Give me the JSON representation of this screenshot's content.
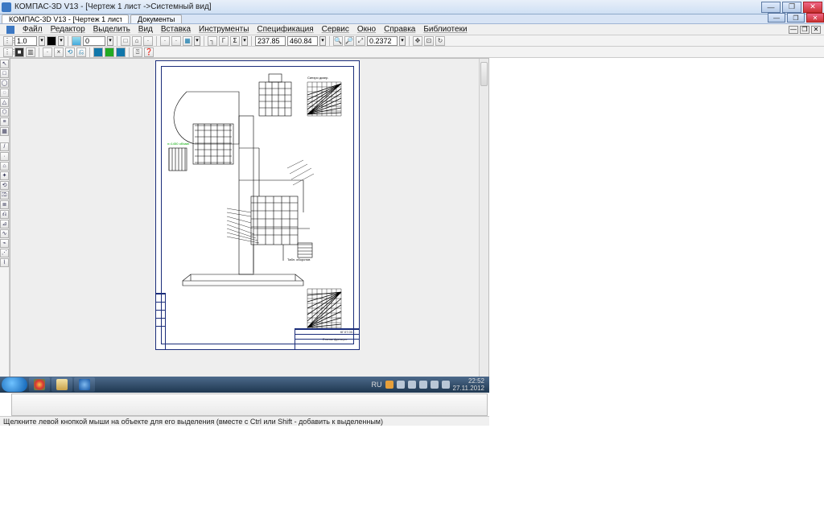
{
  "window": {
    "title": "КОМПАС-3D V13 - [Чертеж 1 лист ->Системный вид]",
    "min": "—",
    "max": "❐",
    "close": "✕"
  },
  "browser_tab": {
    "bg_title": "Документы"
  },
  "menu": {
    "items": [
      "Файл",
      "Редактор",
      "Выделить",
      "Вид",
      "Вставка",
      "Инструменты",
      "Спецификация",
      "Сервис",
      "Окно",
      "Справка",
      "Библиотеки"
    ]
  },
  "mdi": {
    "restore": "❐",
    "min": "—",
    "close": "✕"
  },
  "toolbar2": {
    "line_style_value": "1.0",
    "layer_value": "0",
    "coord_x": "237.85",
    "coord_y": "460.84",
    "zoom_value": "0.2372"
  },
  "left_tools": [
    "↖",
    "□",
    "◯",
    "◌",
    "△",
    "⬡",
    "≡",
    "▦",
    "/",
    "·",
    "⌂",
    "✦",
    "⟲",
    "⎄",
    "≣",
    "⎌",
    "⊿",
    "∿",
    "⌁",
    "⋰",
    "⌇"
  ],
  "tb_icons_row": [
    "□",
    "⌂",
    "·",
    "·",
    "·",
    "¶",
    "≣",
    "≣",
    "≣",
    "≡",
    "⌁",
    "⌁",
    "⌁",
    "Γ",
    "Σ",
    "",
    "",
    " ",
    "⊕",
    "⊖",
    "⤢",
    " ",
    "",
    "⊞",
    "⤢",
    "⊡"
  ],
  "tb_icons_row2": [
    "■",
    "▥",
    "·",
    "×",
    "⟲",
    "⎌",
    "⌂",
    "⍰",
    "❓"
  ],
  "status": {
    "text": "Щелкните левой кнопкой мыши на объекте для его выделения (вместе с Ctrl или Shift - добавить к выделенным)"
  },
  "taskbar": {
    "lang": "RU",
    "time": "22:52",
    "date": "27.11.2012",
    "apps": [
      {
        "name": "chrome",
        "color": "#f4c245"
      },
      {
        "name": "explorer",
        "color": "#f0d27a"
      },
      {
        "name": "kompas",
        "color": "#2f74c0"
      }
    ]
  },
  "drawing": {
    "title_block": {
      "code": "КГ.07.00…",
      "name": "Станок фрезерн."
    },
    "annot1": "Синхро-диаграмма главного",
    "annot2": "Табл. и знак оборотов инструмента"
  }
}
